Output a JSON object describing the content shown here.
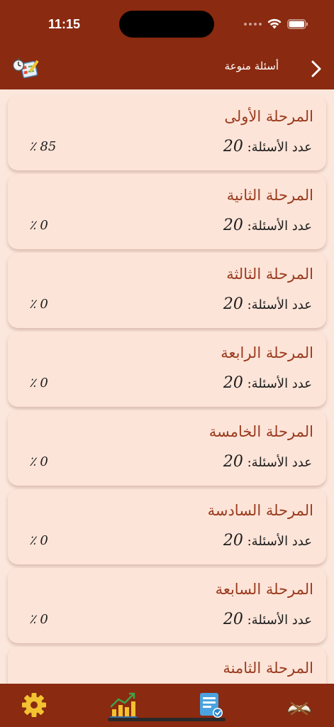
{
  "status": {
    "time": "11:15"
  },
  "nav": {
    "title": "أسئلة منوعة"
  },
  "stages": [
    {
      "title": "المرحلة الأولى",
      "count_label": "عدد الأسئلة:",
      "count": "20",
      "percent": "٪ 85"
    },
    {
      "title": "المرحلة الثانية",
      "count_label": "عدد الأسئلة:",
      "count": "20",
      "percent": "٪ 0"
    },
    {
      "title": "المرحلة الثالثة",
      "count_label": "عدد الأسئلة:",
      "count": "20",
      "percent": "٪ 0"
    },
    {
      "title": "المرحلة الرابعة",
      "count_label": "عدد الأسئلة:",
      "count": "20",
      "percent": "٪ 0"
    },
    {
      "title": "المرحلة الخامسة",
      "count_label": "عدد الأسئلة:",
      "count": "20",
      "percent": "٪ 0"
    },
    {
      "title": "المرحلة السادسة",
      "count_label": "عدد الأسئلة:",
      "count": "20",
      "percent": "٪ 0"
    },
    {
      "title": "المرحلة السابعة",
      "count_label": "عدد الأسئلة:",
      "count": "20",
      "percent": "٪ 0"
    },
    {
      "title": "المرحلة الثامنة",
      "count_label": "",
      "count": "",
      "percent": ""
    }
  ],
  "colors": {
    "bar": "#8a2a10",
    "background": "#fbe7dc",
    "card": "#fde4d8",
    "title": "#9a3b1e",
    "tab_icon": "#f2c230"
  },
  "icons": {
    "nav_back": "chevron-right-icon",
    "nav_quiz": "quiz-clock-icon",
    "tab_quran": "quran-book-icon",
    "tab_quizzes": "quiz-list-icon",
    "tab_stats": "stats-chart-icon",
    "tab_settings": "gear-icon"
  }
}
